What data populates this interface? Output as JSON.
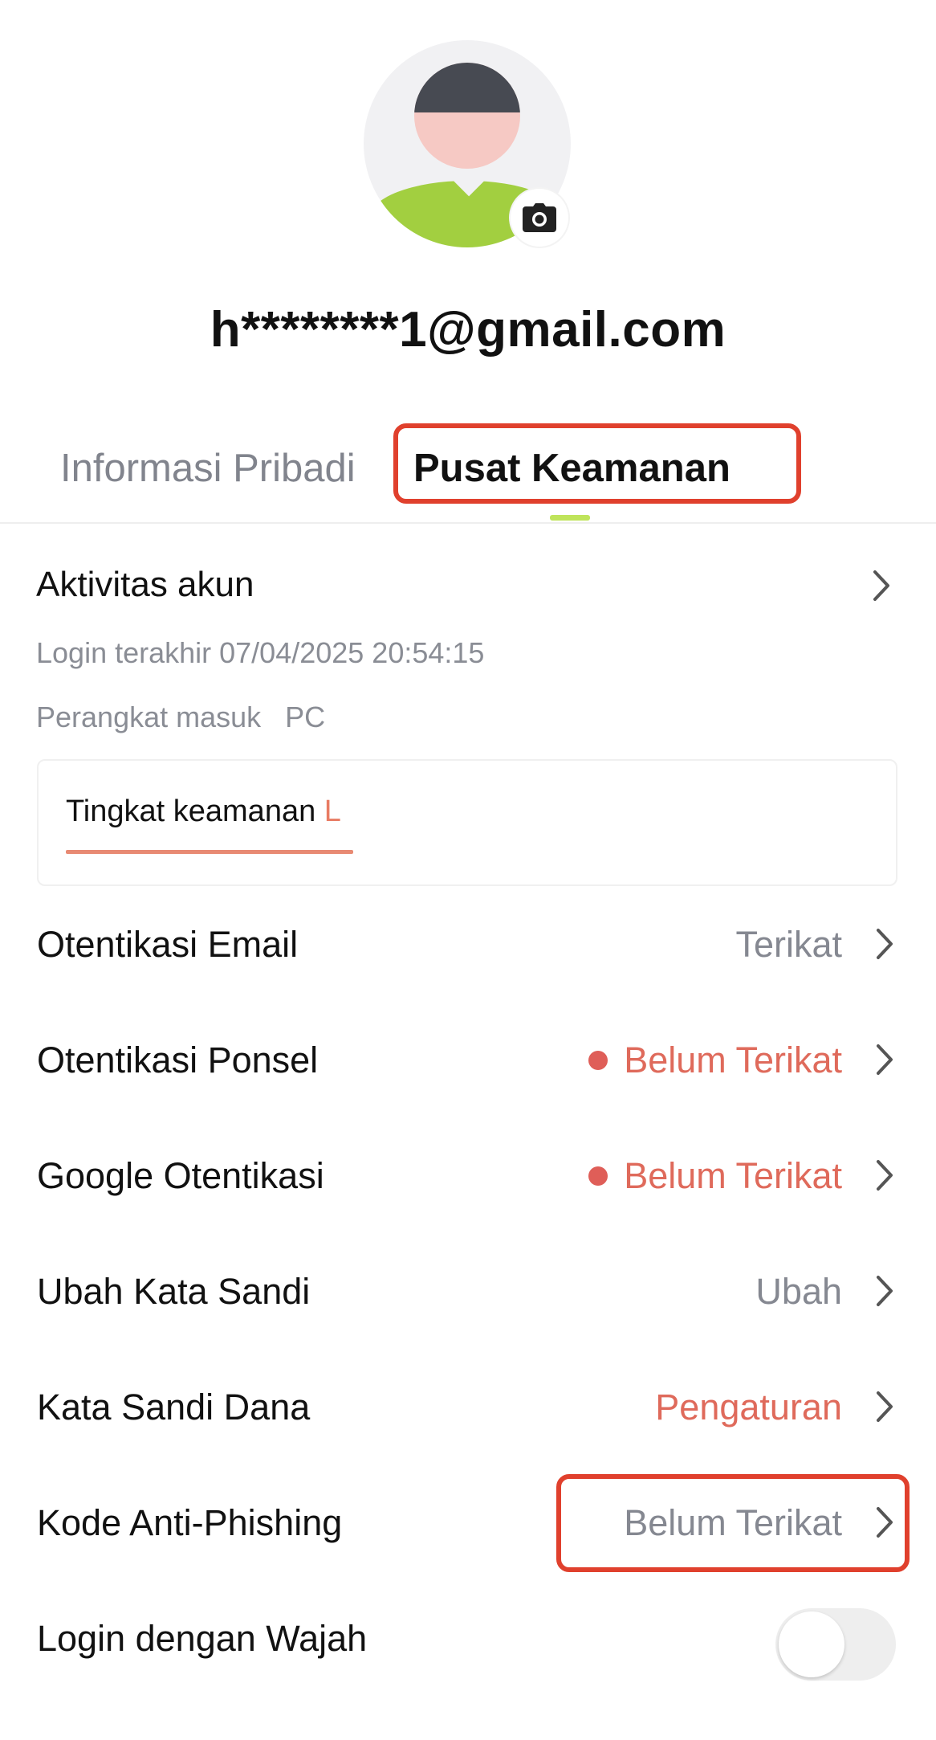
{
  "profile": {
    "email": "h********1@gmail.com"
  },
  "tabs": [
    {
      "label": "Informasi Pribadi",
      "active": false
    },
    {
      "label": "Pusat Keamanan",
      "active": true
    }
  ],
  "activity": {
    "title": "Aktivitas akun",
    "last_login": "Login terakhir 07/04/2025 20:54:15",
    "device": "Perangkat masuk   PC",
    "security_label": "Tingkat keamanan ",
    "security_level": "L"
  },
  "settings": [
    {
      "label": "Otentikasi Email",
      "value": "Terikat",
      "status": "gray"
    },
    {
      "label": "Otentikasi Ponsel",
      "value": "Belum Terikat",
      "status": "red-dot"
    },
    {
      "label": "Google Otentikasi",
      "value": "Belum Terikat",
      "status": "red-dot"
    },
    {
      "label": "Ubah Kata Sandi",
      "value": "Ubah",
      "status": "gray"
    },
    {
      "label": "Kata Sandi Dana",
      "value": "Pengaturan",
      "status": "red"
    },
    {
      "label": "Kode Anti-Phishing",
      "value": "Belum Terikat",
      "status": "gray"
    },
    {
      "label": "Login dengan Wajah",
      "toggle": false
    }
  ],
  "colors": {
    "accent_green": "#a2cf40",
    "warning_red": "#df6a5b",
    "annotation_red": "#e0402d"
  },
  "icons": {
    "camera": "camera-icon",
    "chevron": "chevron-right-icon"
  }
}
